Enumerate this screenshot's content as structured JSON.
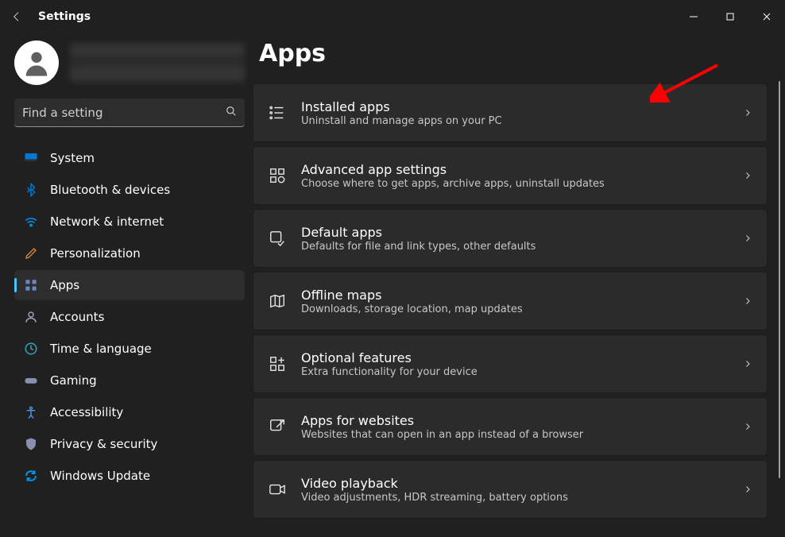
{
  "window": {
    "title": "Settings"
  },
  "search": {
    "placeholder": "Find a setting"
  },
  "nav": [
    {
      "key": "system",
      "label": "System"
    },
    {
      "key": "bluetooth",
      "label": "Bluetooth & devices"
    },
    {
      "key": "network",
      "label": "Network & internet"
    },
    {
      "key": "personalization",
      "label": "Personalization"
    },
    {
      "key": "apps",
      "label": "Apps"
    },
    {
      "key": "accounts",
      "label": "Accounts"
    },
    {
      "key": "time",
      "label": "Time & language"
    },
    {
      "key": "gaming",
      "label": "Gaming"
    },
    {
      "key": "accessibility",
      "label": "Accessibility"
    },
    {
      "key": "privacy",
      "label": "Privacy & security"
    },
    {
      "key": "update",
      "label": "Windows Update"
    }
  ],
  "nav_active": "apps",
  "page": {
    "heading": "Apps",
    "items": [
      {
        "title": "Installed apps",
        "desc": "Uninstall and manage apps on your PC"
      },
      {
        "title": "Advanced app settings",
        "desc": "Choose where to get apps, archive apps, uninstall updates"
      },
      {
        "title": "Default apps",
        "desc": "Defaults for file and link types, other defaults"
      },
      {
        "title": "Offline maps",
        "desc": "Downloads, storage location, map updates"
      },
      {
        "title": "Optional features",
        "desc": "Extra functionality for your device"
      },
      {
        "title": "Apps for websites",
        "desc": "Websites that can open in an app instead of a browser"
      },
      {
        "title": "Video playback",
        "desc": "Video adjustments, HDR streaming, battery options"
      }
    ]
  },
  "annotations": {
    "arrow_target": "installed-apps"
  }
}
